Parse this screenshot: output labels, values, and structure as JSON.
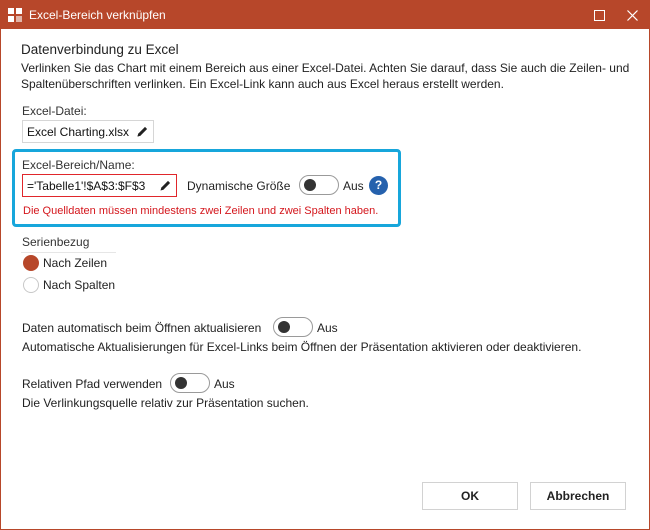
{
  "window": {
    "title": "Excel-Bereich verknüpfen",
    "accent_color": "#b7472a"
  },
  "header": {
    "title": "Datenverbindung zu Excel",
    "description": "Verlinken Sie das Chart mit einem Bereich aus einer Excel-Datei. Achten Sie darauf, dass Sie auch die Zeilen- und Spaltenüberschriften verlinken. Ein Excel-Link kann auch aus Excel heraus erstellt werden."
  },
  "excel_file": {
    "label": "Excel-Datei:",
    "value": "Excel Charting.xlsx"
  },
  "excel_range": {
    "label": "Excel-Bereich/Name:",
    "value": "='Tabelle1'!$A$3:$F$3",
    "error": "Die Quelldaten müssen mindestens zwei Zeilen und zwei Spalten haben.",
    "dynamic_size_label": "Dynamische Größe",
    "dynamic_size_state": "Aus",
    "help_symbol": "?"
  },
  "series": {
    "label": "Serienbezug",
    "options": [
      {
        "label": "Nach Zeilen",
        "checked": true
      },
      {
        "label": "Nach Spalten",
        "checked": false
      }
    ]
  },
  "auto_update": {
    "label": "Daten automatisch beim Öffnen aktualisieren",
    "state": "Aus",
    "description": "Automatische Aktualisierungen für Excel-Links beim Öffnen der Präsentation aktivieren oder deaktivieren."
  },
  "relative_path": {
    "label": "Relativen Pfad verwenden",
    "state": "Aus",
    "description": "Die Verlinkungsquelle relativ zur Präsentation suchen."
  },
  "buttons": {
    "ok": "OK",
    "cancel": "Abbrechen"
  }
}
